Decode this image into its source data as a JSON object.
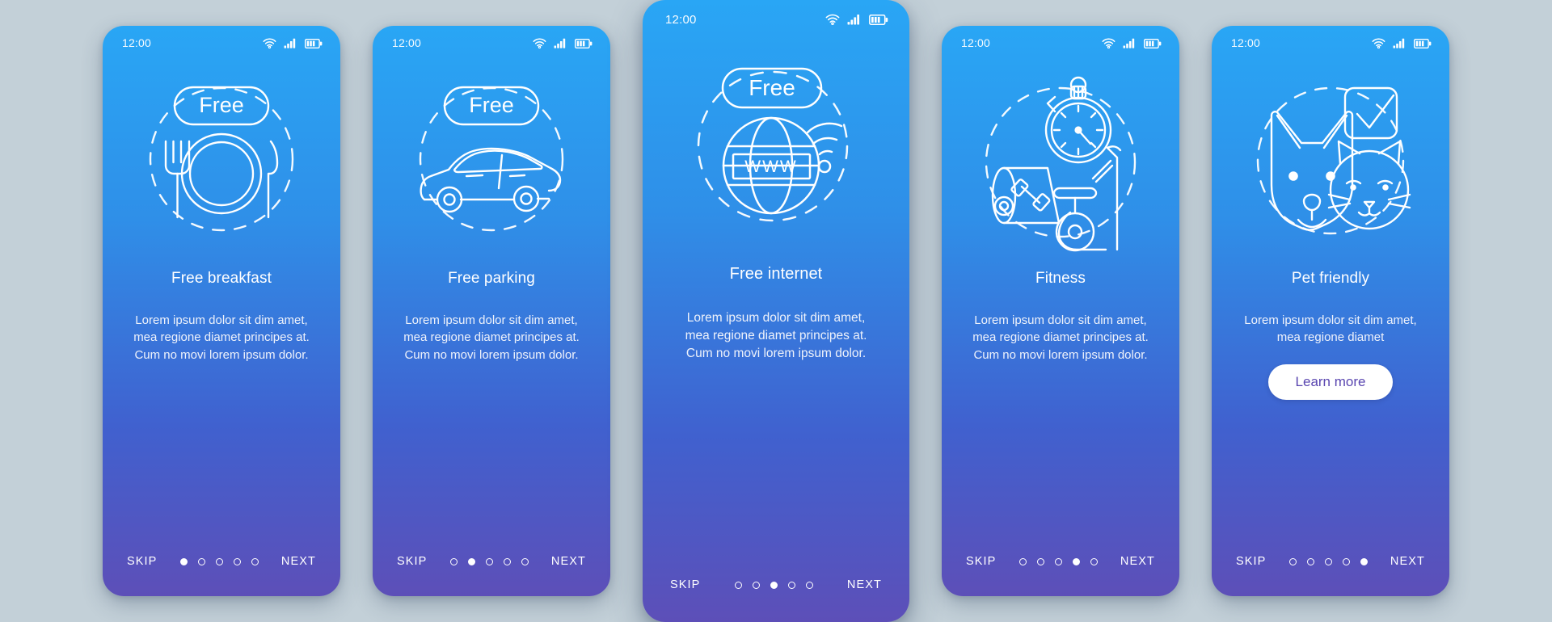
{
  "background_color": "#c3d0d8",
  "status_bar": {
    "time": "12:00",
    "icons": [
      "wifi-icon",
      "cellular-signal-icon",
      "battery-icon"
    ]
  },
  "nav": {
    "skip_label": "SKIP",
    "next_label": "NEXT",
    "total_steps": 5
  },
  "theme": {
    "gradient_top": "#29a6f5",
    "gradient_bottom": "#5d4fb8",
    "cta_text_color": "#5a46b0",
    "text_color": "#ffffff"
  },
  "screens": [
    {
      "id": "free-breakfast",
      "featured": false,
      "active_step": 1,
      "badge": "Free",
      "illustration": "plate-fork-knife-icon",
      "title": "Free breakfast",
      "body": "Lorem ipsum dolor sit dim amet, mea regione diamet principes at. Cum no movi lorem ipsum dolor.",
      "cta": null
    },
    {
      "id": "free-parking",
      "featured": false,
      "active_step": 2,
      "badge": "Free",
      "illustration": "car-icon",
      "title": "Free parking",
      "body": "Lorem ipsum dolor sit dim amet, mea regione diamet principes at. Cum no movi lorem ipsum dolor.",
      "cta": null
    },
    {
      "id": "free-internet",
      "featured": true,
      "active_step": 3,
      "badge": "Free",
      "illustration": "globe-www-wifi-icon",
      "title": "Free internet",
      "body": "Lorem ipsum dolor sit dim amet, mea regione diamet principes at. Cum no movi lorem ipsum dolor.",
      "globe_label": "WWW",
      "cta": null
    },
    {
      "id": "fitness",
      "featured": false,
      "active_step": 4,
      "badge": null,
      "illustration": "stopwatch-yogamat-dumbbell-bike-icon",
      "title": "Fitness",
      "body": "Lorem ipsum dolor sit dim amet, mea regione diamet principes at. Cum no movi lorem ipsum dolor.",
      "cta": null
    },
    {
      "id": "pet-friendly",
      "featured": false,
      "active_step": 5,
      "badge": null,
      "illustration": "dog-cat-checkbox-icon",
      "title": "Pet friendly",
      "body": "Lorem ipsum dolor sit dim amet, mea regione diamet",
      "cta": "Learn more"
    }
  ]
}
